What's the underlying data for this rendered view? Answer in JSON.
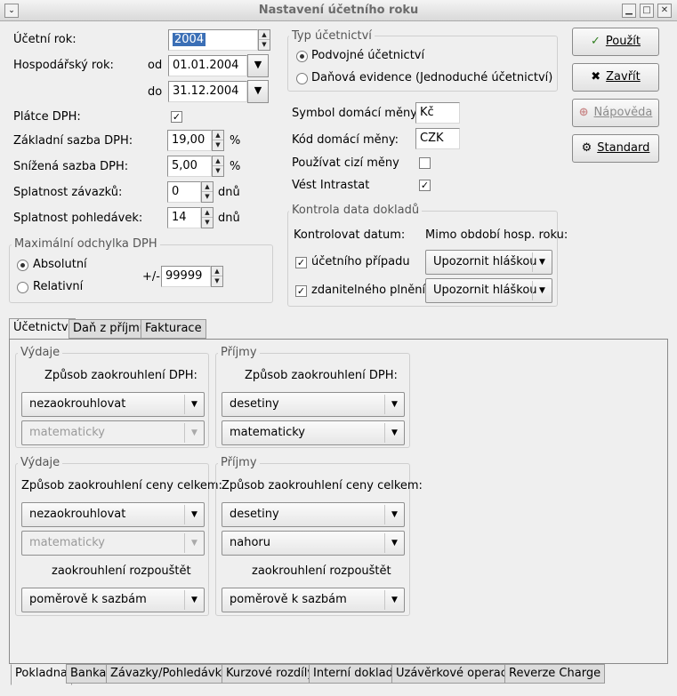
{
  "window": {
    "title": "Nastavení účetního roku"
  },
  "fields": {
    "ucetni_rok_label": "Účetní rok:",
    "ucetni_rok_value": "2004",
    "hosp_rok_label": "Hospodářský rok:",
    "od_label": "od",
    "od_value": "01.01.2004",
    "do_label": "do",
    "do_value": "31.12.2004",
    "platce_dph_label": "Plátce DPH:",
    "zakladni_label": "Základní sazba DPH:",
    "zakladni_value": "19,00",
    "snizena_label": "Snížená sazba DPH:",
    "snizena_value": "5,00",
    "percent": "%",
    "splatnost_zav_label": "Splatnost závazků:",
    "splatnost_zav_value": "0",
    "splatnost_pohl_label": "Splatnost pohledávek:",
    "splatnost_pohl_value": "14",
    "dnu": "dnů"
  },
  "max_odchylka": {
    "title": "Maximální odchylka DPH",
    "absolutni": "Absolutní",
    "relativni": "Relativní",
    "plusminus": "+/-",
    "value": "99999"
  },
  "typ_ucetnictvi": {
    "title": "Typ účetnictví",
    "podvojne": "Podvojné účetnictví",
    "danova": "Daňová evidence (Jednoduché účetnictví)"
  },
  "mena": {
    "symbol_label": "Symbol domácí měny:",
    "symbol_value": "Kč",
    "kod_label": "Kód domácí měny:",
    "kod_value": "CZK",
    "cizi_label": "Používat cizí měny",
    "intrastat_label": "Vést Intrastat"
  },
  "kontrola": {
    "title": "Kontrola data dokladů",
    "kontrolovat_label": "Kontrolovat datum:",
    "mimo_label": "Mimo období hosp. roku:",
    "ucetniho_pripadu": "účetního případu",
    "zdanitelneho_plneni": "zdanitelného plnění",
    "combo1": "Upozornit hláškou",
    "combo2": "Upozornit hláškou"
  },
  "buttons": {
    "pouzit": "Použít",
    "zavrit": "Zavřít",
    "napoveda": "Nápověda",
    "standard": "Standard"
  },
  "top_tabs": [
    "Účetnictví",
    "Daň z příjmů",
    "Fakturace"
  ],
  "bottom_tabs": [
    "Pokladna",
    "Banka",
    "Závazky/Pohledávky",
    "Kurzové rozdíly",
    "Interní doklady",
    "Uzávěrkové operace",
    "Reverze Charge"
  ],
  "panel": {
    "vydaje1": {
      "title": "Výdaje",
      "label": "Způsob zaokrouhlení DPH:",
      "combo1": "nezaokrouhlovat",
      "combo2": "matematicky"
    },
    "prijmy1": {
      "title": "Příjmy",
      "label": "Způsob zaokrouhlení DPH:",
      "combo1": "desetiny",
      "combo2": "matematicky"
    },
    "vydaje2": {
      "title": "Výdaje",
      "label": "Způsob zaokrouhlení ceny celkem:",
      "combo1": "nezaokrouhlovat",
      "combo2": "matematicky",
      "rozp_label": "zaokrouhlení rozpouštět",
      "combo3": "poměrově k sazbám"
    },
    "prijmy2": {
      "title": "Příjmy",
      "label": "Způsob zaokrouhlení ceny celkem:",
      "combo1": "desetiny",
      "combo2": "nahoru",
      "rozp_label": "zaokrouhlení rozpouštět",
      "combo3": "poměrově k sazbám"
    }
  }
}
